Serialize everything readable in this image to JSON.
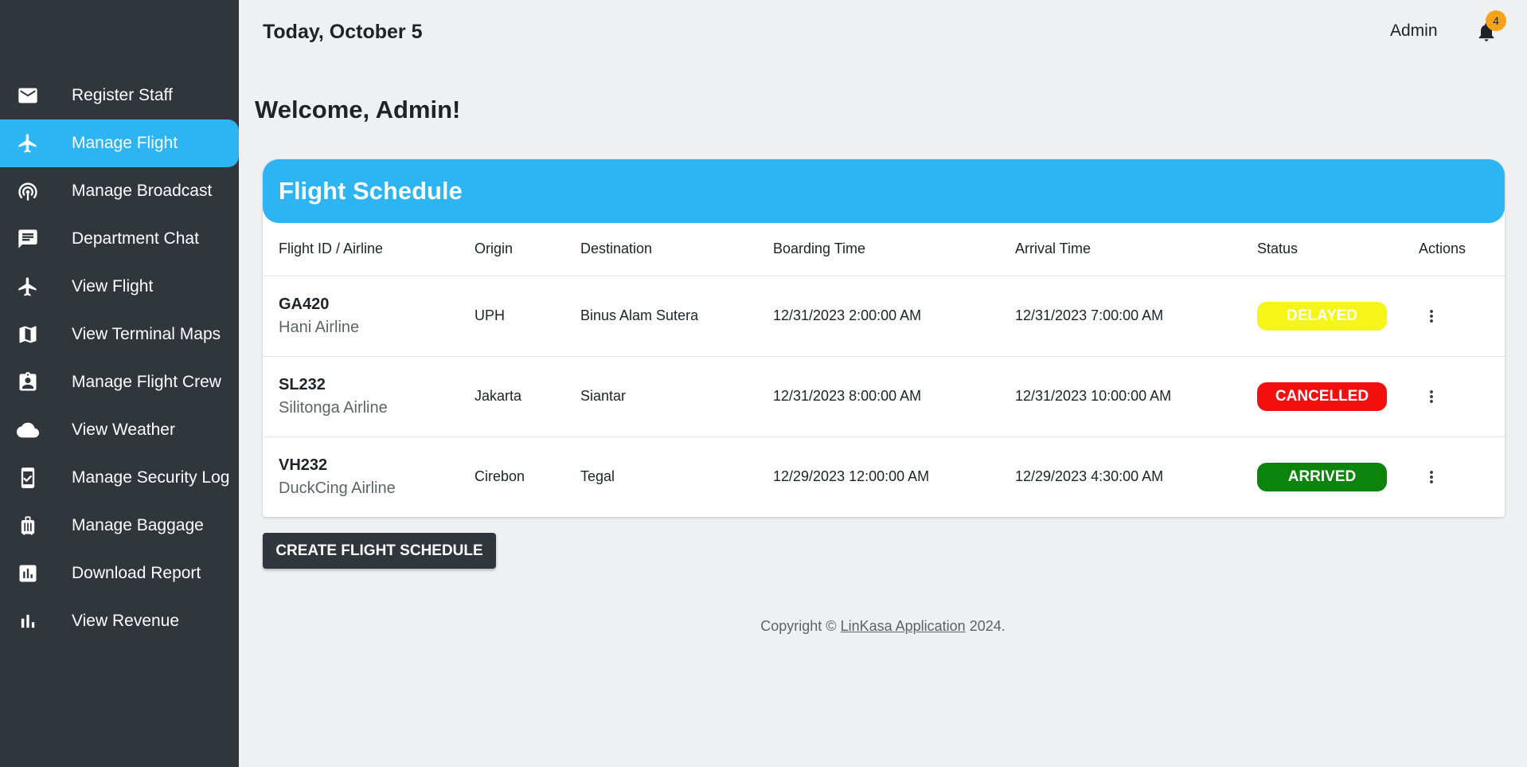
{
  "header": {
    "date": "Today, October 5",
    "user": "Admin",
    "notification_count": "4"
  },
  "sidebar": {
    "items": [
      {
        "label": "Register Staff",
        "icon": "mail-icon",
        "active": false
      },
      {
        "label": "Manage Flight",
        "icon": "airplane-icon",
        "active": true
      },
      {
        "label": "Manage Broadcast",
        "icon": "broadcast-icon",
        "active": false
      },
      {
        "label": "Department Chat",
        "icon": "chat-icon",
        "active": false
      },
      {
        "label": "View Flight",
        "icon": "airplane-icon",
        "active": false
      },
      {
        "label": "View Terminal Maps",
        "icon": "map-icon",
        "active": false
      },
      {
        "label": "Manage Flight Crew",
        "icon": "badge-icon",
        "active": false
      },
      {
        "label": "View Weather",
        "icon": "cloud-icon",
        "active": false
      },
      {
        "label": "Manage Security Log",
        "icon": "checklist-icon",
        "active": false
      },
      {
        "label": "Manage Baggage",
        "icon": "luggage-icon",
        "active": false
      },
      {
        "label": "Download Report",
        "icon": "report-icon",
        "active": false
      },
      {
        "label": "View Revenue",
        "icon": "bar-chart-icon",
        "active": false
      }
    ]
  },
  "main": {
    "welcome": "Welcome, Admin!",
    "card_title": "Flight Schedule",
    "columns": [
      "Flight ID / Airline",
      "Origin",
      "Destination",
      "Boarding Time",
      "Arrival Time",
      "Status",
      "Actions"
    ],
    "rows": [
      {
        "flight_id": "GA420",
        "airline": "Hani Airline",
        "origin": "UPH",
        "destination": "Binus Alam Sutera",
        "boarding": "12/31/2023 2:00:00 AM",
        "arrival": "12/31/2023 7:00:00 AM",
        "status": "DELAYED",
        "status_color": "#f5f51a"
      },
      {
        "flight_id": "SL232",
        "airline": "Silitonga Airline",
        "origin": "Jakarta",
        "destination": "Siantar",
        "boarding": "12/31/2023 8:00:00 AM",
        "arrival": "12/31/2023 10:00:00 AM",
        "status": "CANCELLED",
        "status_color": "#f40f0f"
      },
      {
        "flight_id": "VH232",
        "airline": "DuckCing Airline",
        "origin": "Cirebon",
        "destination": "Tegal",
        "boarding": "12/29/2023 12:00:00 AM",
        "arrival": "12/29/2023 4:30:00 AM",
        "status": "ARRIVED",
        "status_color": "#0c840c"
      }
    ],
    "create_button": "CREATE FLIGHT SCHEDULE"
  },
  "footer": {
    "prefix": "Copyright © ",
    "link": "LinKasa Application",
    "suffix": " 2024."
  },
  "colors": {
    "sidebar_bg": "#31363d",
    "accent": "#2db4f3",
    "badge": "#f7a21b"
  }
}
